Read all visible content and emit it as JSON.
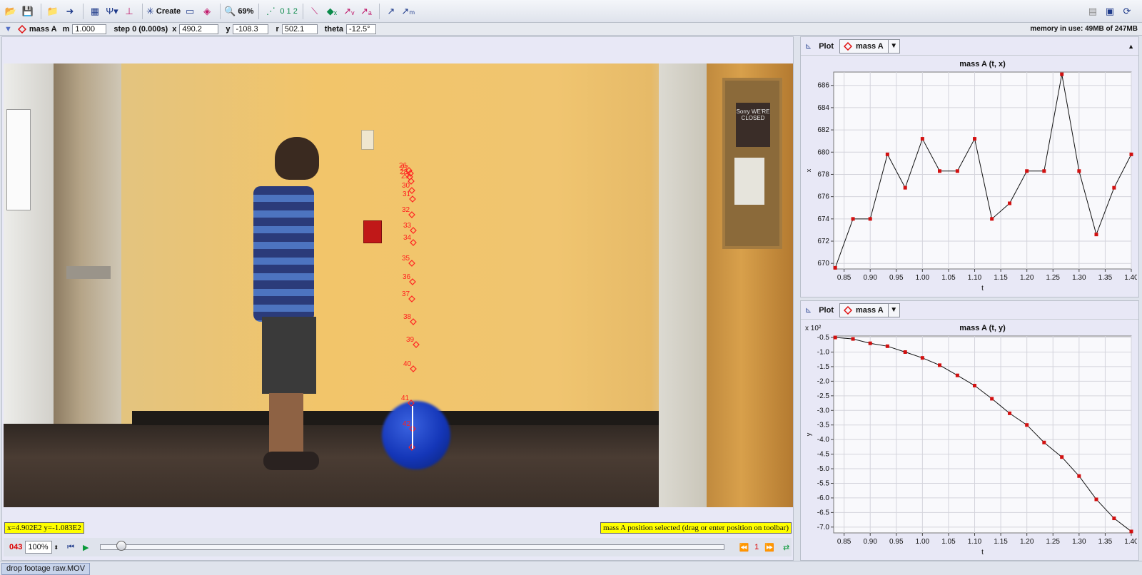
{
  "toolbar": {
    "create_label": "Create",
    "zoom_label": "69%",
    "subscript_label": "0 1 2"
  },
  "propbar": {
    "track_name": "mass A",
    "m_label": "m",
    "m_value": "1.000",
    "step_label": "step 0 (0.000s)",
    "x_label": "x",
    "x_value": "490.2",
    "y_label": "y",
    "y_value": "-108.3",
    "r_label": "r",
    "r_value": "502.1",
    "theta_label": "theta",
    "theta_value": "-12.5°",
    "memory": "memory in use: 49MB of 247MB"
  },
  "video": {
    "status_left": "x=4.902E2  y=-1.083E2",
    "status_right": "mass A position selected (drag or enter position on toolbar)",
    "marker_labels": [
      "26",
      "27",
      "28",
      "29",
      "30",
      "31",
      "32",
      "33",
      "34",
      "35",
      "36",
      "37",
      "38",
      "39",
      "40",
      "41",
      "42"
    ],
    "sign_text": "Sorry WE'RE CLOSED"
  },
  "player": {
    "frame": "043",
    "zoom": "100%",
    "step_count": "1"
  },
  "tab": {
    "label": "drop footage raw.MOV"
  },
  "plots": [
    {
      "plot_label": "Plot",
      "track_label": "mass A"
    },
    {
      "plot_label": "Plot",
      "track_label": "mass A"
    }
  ],
  "chart_data": [
    {
      "type": "line",
      "title": "mass A (t, x)",
      "xlabel": "t",
      "ylabel": "x",
      "xlim": [
        0.83,
        1.4
      ],
      "ylim": [
        669.5,
        687.2
      ],
      "x_ticks": [
        "0.85",
        "0.90",
        "0.95",
        "1.00",
        "1.05",
        "1.10",
        "1.15",
        "1.20",
        "1.25",
        "1.30",
        "1.35",
        "1.40"
      ],
      "y_ticks": [
        "670",
        "672",
        "674",
        "676",
        "678",
        "680",
        "682",
        "684",
        "686"
      ],
      "x": [
        0.833,
        0.867,
        0.9,
        0.933,
        0.967,
        1.0,
        1.033,
        1.067,
        1.1,
        1.133,
        1.167,
        1.2,
        1.233,
        1.267,
        1.3,
        1.333,
        1.367,
        1.4
      ],
      "values": [
        669.6,
        674.0,
        674.0,
        679.8,
        676.8,
        681.2,
        678.3,
        678.3,
        681.2,
        674.0,
        675.4,
        678.3,
        678.3,
        687.0,
        678.3,
        672.6,
        676.8,
        679.8
      ],
      "grid": true
    },
    {
      "type": "line",
      "title": "mass A (t, y)",
      "xlabel": "t",
      "ylabel": "y",
      "y_multiplier": "x 10²",
      "xlim": [
        0.83,
        1.4
      ],
      "ylim": [
        -7.2,
        -0.45
      ],
      "x_ticks": [
        "0.85",
        "0.90",
        "0.95",
        "1.00",
        "1.05",
        "1.10",
        "1.15",
        "1.20",
        "1.25",
        "1.30",
        "1.35",
        "1.40"
      ],
      "y_ticks": [
        "-0.5",
        "-1.0",
        "-1.5",
        "-2.0",
        "-2.5",
        "-3.0",
        "-3.5",
        "-4.0",
        "-4.5",
        "-5.0",
        "-5.5",
        "-6.0",
        "-6.5",
        "-7.0"
      ],
      "x": [
        0.833,
        0.867,
        0.9,
        0.933,
        0.967,
        1.0,
        1.033,
        1.067,
        1.1,
        1.133,
        1.167,
        1.2,
        1.233,
        1.267,
        1.3,
        1.333,
        1.367,
        1.4
      ],
      "values": [
        -0.5,
        -0.55,
        -0.7,
        -0.8,
        -1.0,
        -1.2,
        -1.45,
        -1.8,
        -2.15,
        -2.6,
        -3.1,
        -3.5,
        -4.1,
        -4.6,
        -5.25,
        -6.05,
        -6.7,
        -7.15
      ],
      "grid": true
    }
  ]
}
